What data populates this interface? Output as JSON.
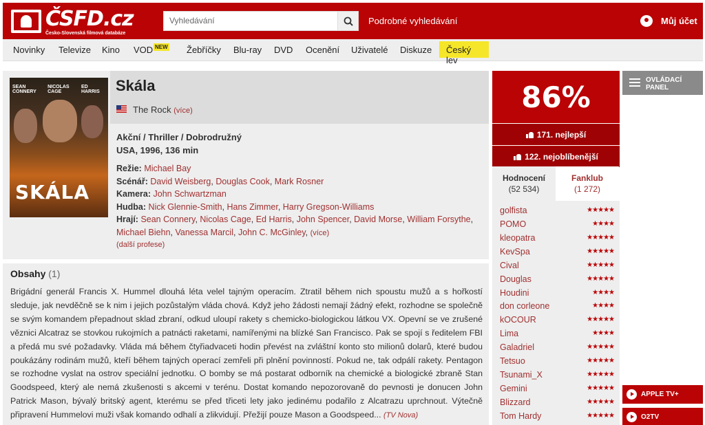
{
  "header": {
    "logo_text": "ČSFD.cz",
    "logo_subtitle": "Česko-Slovenská filmová databáze",
    "search_placeholder": "Vyhledávání",
    "advanced_search": "Podrobné vyhledávání",
    "account_label": "Můj účet"
  },
  "nav": {
    "items": [
      "Novinky",
      "Televize",
      "Kino",
      "VOD",
      "Žebříčky",
      "Blu-ray",
      "DVD",
      "Ocenění",
      "Uživatelé",
      "Diskuze",
      "Český lev"
    ],
    "new_badge": "NEW"
  },
  "film": {
    "poster_names": [
      "SEAN CONNERY",
      "NICOLAS CAGE",
      "ED HARRIS"
    ],
    "poster_title": "SKÁLA",
    "title": "Skála",
    "original_title": "The Rock",
    "more_link": "(více)",
    "genres": "Akční / Thriller / Dobrodružný",
    "origin": "USA, 1996, 136 min",
    "director_label": "Režie:",
    "director": "Michael Bay",
    "screenplay_label": "Scénář:",
    "screenplay": [
      "David Weisberg",
      "Douglas Cook",
      "Mark Rosner"
    ],
    "camera_label": "Kamera:",
    "camera": "John Schwartzman",
    "music_label": "Hudba:",
    "music": [
      "Nick Glennie-Smith",
      "Hans Zimmer",
      "Harry Gregson-Williams"
    ],
    "cast_label": "Hrají:",
    "cast": [
      "Sean Connery",
      "Nicolas Cage",
      "Ed Harris",
      "John Spencer",
      "David Morse",
      "William Forsythe",
      "Michael Biehn",
      "Vanessa Marcil",
      "John C. McGinley"
    ],
    "cast_more": "(více)",
    "more_professions": "(další profese)"
  },
  "plot": {
    "heading": "Obsahy",
    "count": "(1)",
    "text": "Brigádní generál Francis X. Hummel dlouhá léta velel tajným operacím. Ztratil během nich spoustu mužů a s hořkostí sleduje, jak nevděčně se k nim i jejich pozůstalým vláda chová. Když jeho žádosti nemají žádný efekt, rozhodne se společně se svým komandem přepadnout sklad zbraní, odkud uloupí rakety s chemicko-biologickou látkou VX. Opevní se ve zrušené věznici Alcatraz se stovkou rukojmích a patnácti raketami, namířenými na blízké San Francisco. Pak se spojí s ředitelem FBI a předá mu své požadavky. Vláda má během čtyřiadvaceti hodin převést na zvláštní konto sto milionů dolarů, které budou poukázány rodinám mužů, kteří během tajných operací zemřeli při plnění povinností. Pokud ne, tak odpálí rakety. Pentagon se rozhodne vyslat na ostrov speciální jednotku. O bomby se má postarat odborník na chemické a biologické zbraně Stan Goodspeed, který ale nemá zkušenosti s akcemi v terénu. Dostat komando nepozorovaně do pevnosti je donucen John Patrick Mason, bývalý britský agent, kterému se před třiceti lety jako jedinému podařilo z Alcatrazu uprchnout. Výtečně připravení Hummelovi muži však komando odhalí a zlikvidují. Přežijí pouze Mason a Goodspeed...",
    "source": "(TV Nova)"
  },
  "rating": {
    "percent": "86%",
    "best_rank": "171. nejlepší",
    "popular_rank": "122. nejoblíbenější",
    "tab_ratings": "Hodnocení",
    "tab_ratings_count": "(52 534)",
    "tab_fanclub": "Fanklub",
    "tab_fanclub_count": "(1 272)",
    "users": [
      {
        "name": "golfista",
        "stars": 5
      },
      {
        "name": "POMO",
        "stars": 4
      },
      {
        "name": "kleopatra",
        "stars": 5
      },
      {
        "name": "KevSpa",
        "stars": 5
      },
      {
        "name": "Cival",
        "stars": 5
      },
      {
        "name": "Douglas",
        "stars": 5
      },
      {
        "name": "Houdini",
        "stars": 4
      },
      {
        "name": "don corleone",
        "stars": 4
      },
      {
        "name": "kOCOUR",
        "stars": 5
      },
      {
        "name": "Lima",
        "stars": 4
      },
      {
        "name": "Galadriel",
        "stars": 5
      },
      {
        "name": "Tetsuo",
        "stars": 5
      },
      {
        "name": "Tsunami_X",
        "stars": 5
      },
      {
        "name": "Gemini",
        "stars": 5
      },
      {
        "name": "Blizzard",
        "stars": 5
      },
      {
        "name": "Tom Hardy",
        "stars": 5
      }
    ]
  },
  "sidebar": {
    "control_panel": "OVLÁDACÍ PANEL",
    "vod": [
      "APPLE TV+",
      "O2TV"
    ]
  },
  "colors": {
    "brand_red": "#ba0305",
    "accent_yellow": "#f6e629"
  }
}
